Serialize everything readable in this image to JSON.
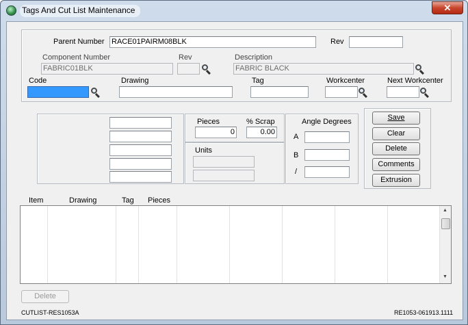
{
  "window": {
    "title": "Tags And Cut List Maintenance",
    "close_glyph": "✕"
  },
  "header": {
    "parent_number_label": "Parent Number",
    "parent_number_value": "RACE01PAIRM08BLK",
    "rev_label": "Rev",
    "rev_value": "",
    "component_number_label": "Component Number",
    "component_number_value": "FABRIC01BLK",
    "component_rev_label": "Rev",
    "component_rev_value": "",
    "description_label": "Description",
    "description_value": "FABRIC BLACK",
    "code_label": "Code",
    "code_value": "",
    "drawing_label": "Drawing",
    "drawing_value": "",
    "tag_label": "Tag",
    "tag_value": "",
    "workcenter_label": "Workcenter",
    "workcenter_value": "",
    "next_workcenter_label": "Next Workcenter",
    "next_workcenter_value": ""
  },
  "details": {
    "side_fields": [
      "",
      "",
      "",
      "",
      ""
    ],
    "pieces_label": "Pieces",
    "pieces_value": "0",
    "scrap_label": "% Scrap",
    "scrap_value": "0.00",
    "units_label": "Units",
    "units_values": [
      "",
      ""
    ],
    "angle_label": "Angle Degrees",
    "angle_a_label": "A",
    "angle_b_label": "B",
    "angle_slash_label": "/",
    "angle_values": [
      "",
      "",
      ""
    ]
  },
  "actions": {
    "save": "Save",
    "clear": "Clear",
    "delete": "Delete",
    "comments": "Comments",
    "extrusion": "Extrusion"
  },
  "grid": {
    "columns": [
      "Item",
      "Drawing",
      "Tag",
      "Pieces"
    ],
    "rows": []
  },
  "footer": {
    "delete_label": "Delete",
    "left_status": "CUTLIST-RES1053A",
    "right_status": "RE1053-061913.1111"
  },
  "icons": [
    "app-icon",
    "close-icon",
    "search-icon"
  ],
  "colors": {
    "focused_input": "#3399ff",
    "close_button": "#c8462e"
  }
}
